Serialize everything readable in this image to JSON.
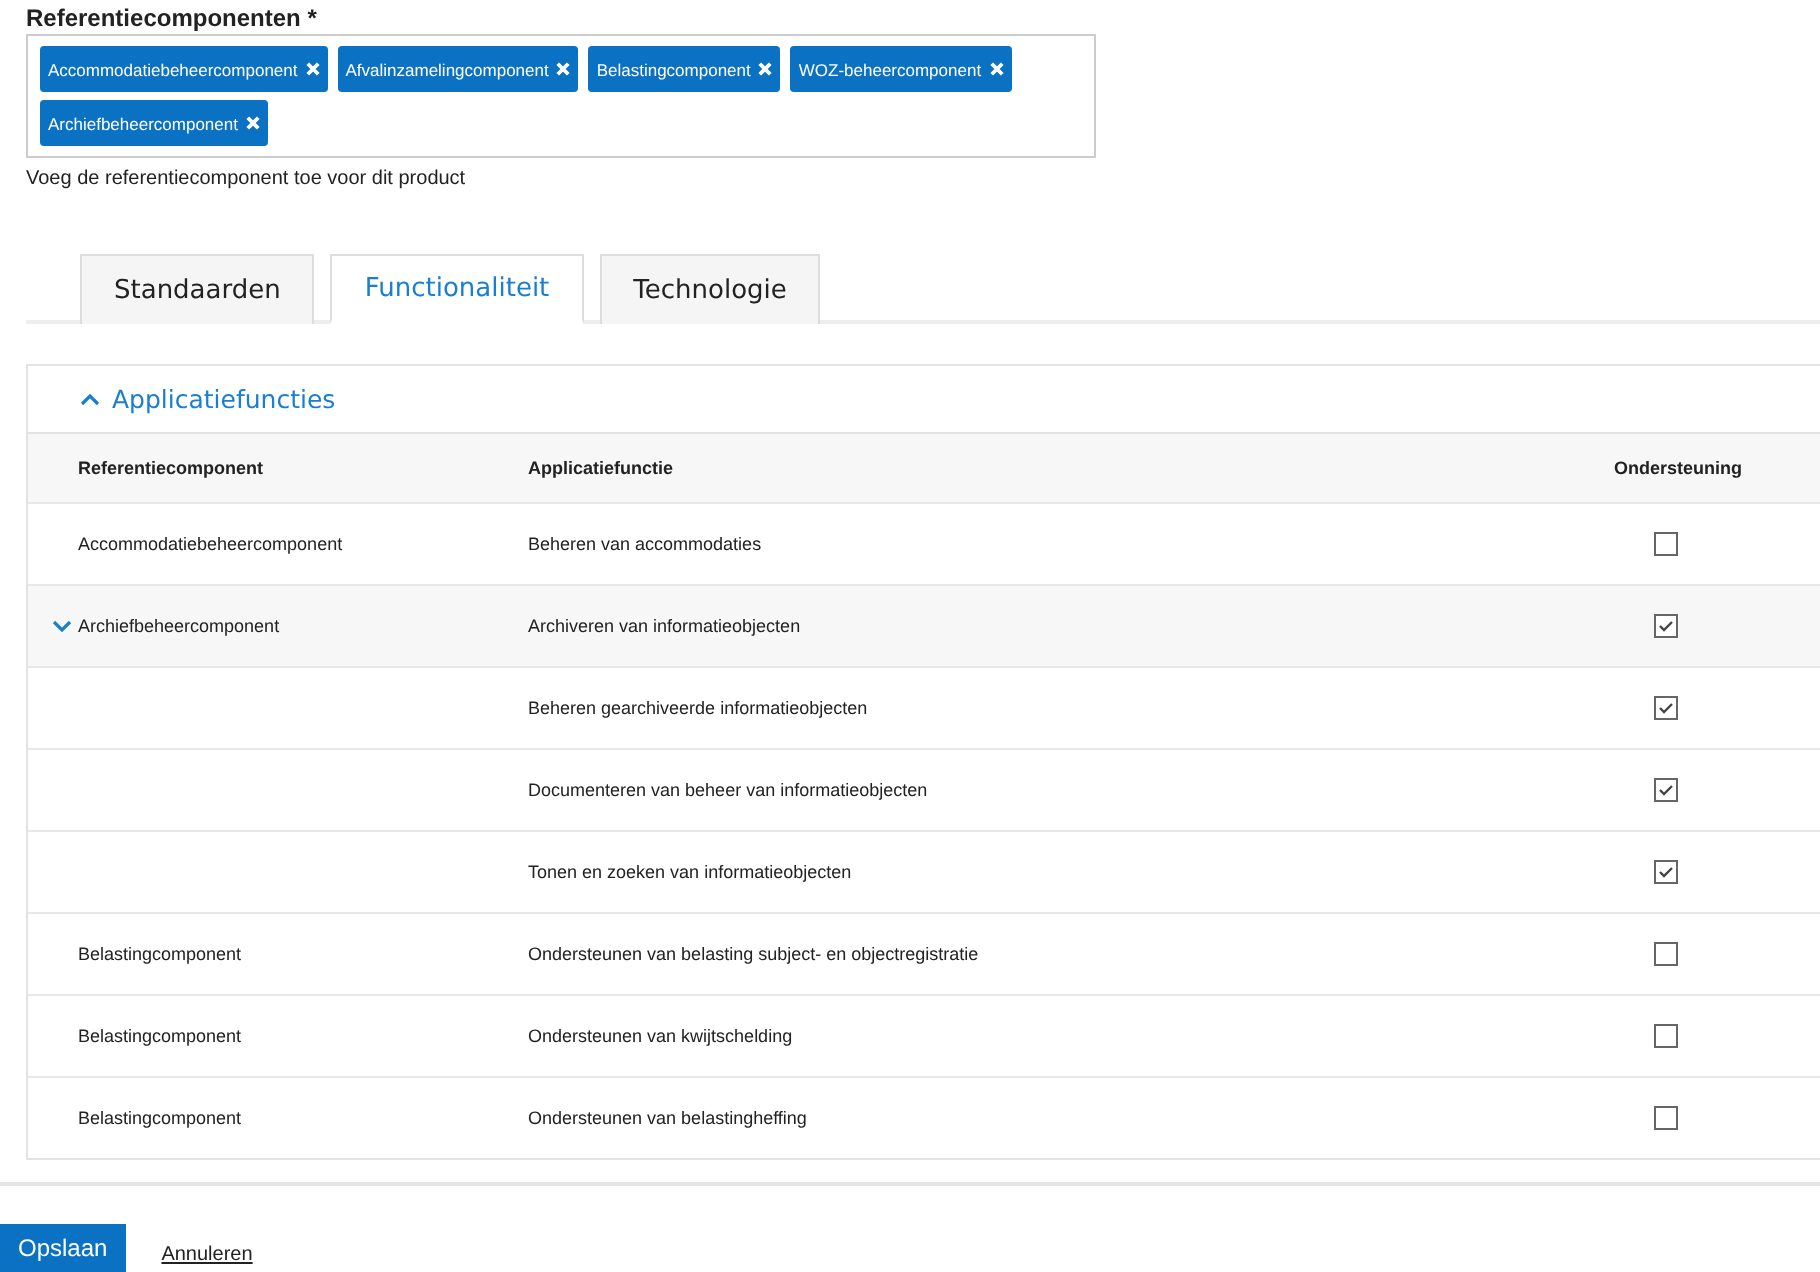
{
  "field": {
    "label": "Referentiecomponenten *",
    "tags": [
      "Accommodatiebeheercomponent",
      "Afvalinzamelingcomponent",
      "Belastingcomponent",
      "WOZ-beheercomponent",
      "Archiefbeheercomponent"
    ],
    "help": "Voeg de referentiecomponent toe voor dit product"
  },
  "tabs": [
    {
      "label": "Standaarden",
      "selected": false
    },
    {
      "label": "Functionaliteit",
      "selected": true
    },
    {
      "label": "Technologie",
      "selected": false
    }
  ],
  "section": {
    "title": "Applicatiefuncties",
    "expanded": true,
    "columns": [
      "Referentiecomponent",
      "Applicatiefunctie",
      "Ondersteuning"
    ],
    "rows": [
      {
        "component": "Accommodatiebeheercomponent",
        "function": "Beheren van accommodaties",
        "checked": false
      },
      {
        "component": "Archiefbeheercomponent",
        "expanded": true,
        "function": "Archiveren van informatieobjecten",
        "checked": true,
        "children": [
          {
            "function": "Beheren gearchiveerde informatieobjecten",
            "checked": true
          },
          {
            "function": "Documenteren van beheer van informatieobjecten",
            "checked": true
          },
          {
            "function": "Tonen en zoeken van informatieobjecten",
            "checked": true
          }
        ]
      },
      {
        "component": "Belastingcomponent",
        "function": "Ondersteunen van belasting subject- en objectregistratie",
        "checked": false
      },
      {
        "component": "Belastingcomponent",
        "function": "Ondersteunen van kwijtschelding",
        "checked": false
      },
      {
        "component": "Belastingcomponent",
        "function": "Ondersteunen van belastingheffing",
        "checked": false
      }
    ]
  },
  "buttons": {
    "save": "Opslaan",
    "cancel": "Annuleren"
  }
}
